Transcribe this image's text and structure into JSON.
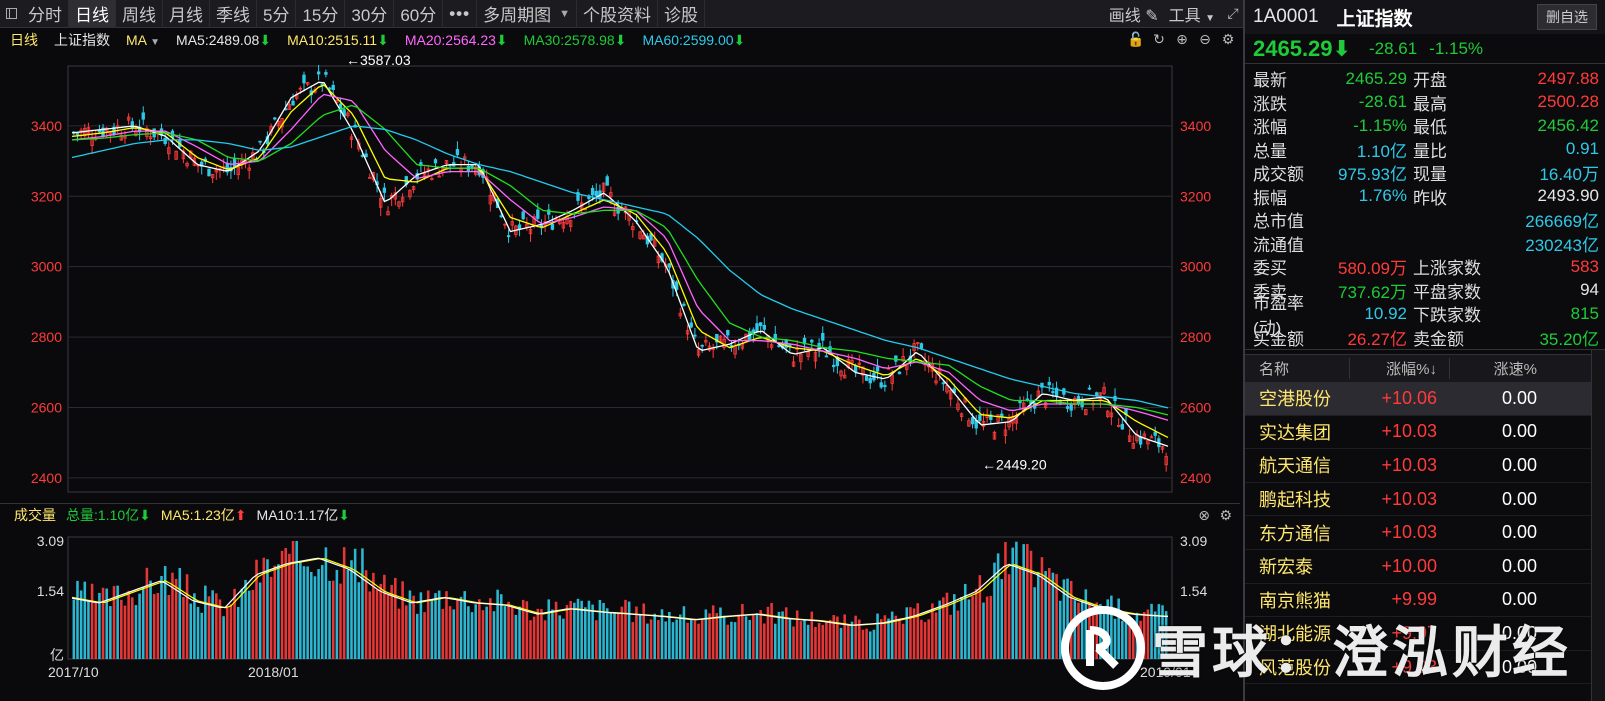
{
  "toolbar": {
    "tabs": [
      {
        "label": "分时"
      },
      {
        "label": "日线"
      },
      {
        "label": "周线"
      },
      {
        "label": "月线"
      },
      {
        "label": "季线"
      },
      {
        "label": "5分"
      },
      {
        "label": "15分"
      },
      {
        "label": "30分"
      },
      {
        "label": "60分"
      },
      {
        "label": "•••"
      },
      {
        "label": "多周期图"
      },
      {
        "label": "个股资料"
      },
      {
        "label": "诊股"
      }
    ],
    "active_tab": "日线",
    "draw_label": "画线",
    "tools_label": "工具"
  },
  "infobar": {
    "period": "日线",
    "name": "上证指数",
    "indicator": "MA",
    "ma5": "MA5:2489.08",
    "ma10": "MA10:2515.11",
    "ma20": "MA20:2564.23",
    "ma30": "MA30:2578.98",
    "ma60": "MA60:2599.00"
  },
  "chart_data": {
    "type": "line",
    "title": "上证指数",
    "y_ticks": [
      3400,
      3200,
      3000,
      2800,
      2600,
      2400
    ],
    "ylim": [
      2360,
      3570
    ],
    "x_ticks": [
      "2017/10",
      "2018/01",
      "2019/01"
    ],
    "annotations": [
      {
        "text": "←3587.03",
        "value": 3587.03
      },
      {
        "text": "←2449.20",
        "value": 2449.2
      }
    ],
    "series": [
      {
        "name": "MA5",
        "color": "#ffffff",
        "values": [
          3380,
          3390,
          3400,
          3370,
          3290,
          3270,
          3330,
          3480,
          3530,
          3380,
          3180,
          3260,
          3290,
          3290,
          3100,
          3120,
          3160,
          3210,
          3130,
          3000,
          2760,
          2780,
          2820,
          2750,
          2770,
          2700,
          2680,
          2760,
          2660,
          2550,
          2560,
          2640,
          2620,
          2630,
          2520,
          2490
        ]
      },
      {
        "name": "MA10",
        "color": "#ffff00",
        "values": [
          3370,
          3380,
          3395,
          3380,
          3310,
          3275,
          3310,
          3440,
          3520,
          3430,
          3250,
          3240,
          3280,
          3280,
          3140,
          3110,
          3150,
          3190,
          3150,
          3040,
          2820,
          2770,
          2800,
          2770,
          2760,
          2720,
          2690,
          2740,
          2680,
          2580,
          2570,
          2620,
          2620,
          2620,
          2560,
          2515
        ]
      },
      {
        "name": "MA20",
        "color": "#ff66ff",
        "values": [
          3360,
          3370,
          3385,
          3385,
          3340,
          3290,
          3300,
          3390,
          3490,
          3470,
          3330,
          3250,
          3270,
          3270,
          3190,
          3120,
          3140,
          3170,
          3160,
          3080,
          2880,
          2790,
          2790,
          2780,
          2760,
          2740,
          2710,
          2730,
          2700,
          2620,
          2590,
          2610,
          2610,
          2610,
          2590,
          2564
        ]
      },
      {
        "name": "MA30",
        "color": "#22dd22",
        "values": [
          3360,
          3365,
          3375,
          3380,
          3360,
          3310,
          3300,
          3350,
          3430,
          3460,
          3390,
          3290,
          3280,
          3280,
          3230,
          3160,
          3150,
          3160,
          3160,
          3110,
          2960,
          2840,
          2800,
          2790,
          2770,
          2760,
          2740,
          2730,
          2720,
          2660,
          2620,
          2620,
          2610,
          2610,
          2600,
          2579
        ]
      },
      {
        "name": "MA60",
        "color": "#22ccee",
        "values": [
          3310,
          3330,
          3350,
          3360,
          3360,
          3350,
          3330,
          3340,
          3370,
          3400,
          3390,
          3360,
          3320,
          3290,
          3270,
          3240,
          3210,
          3190,
          3170,
          3150,
          3080,
          2990,
          2920,
          2880,
          2850,
          2820,
          2790,
          2770,
          2740,
          2710,
          2680,
          2660,
          2640,
          2630,
          2620,
          2599
        ]
      }
    ]
  },
  "volume": {
    "label": "成交量",
    "total": "总量:1.10亿",
    "ma5": "MA5:1.23亿",
    "ma10": "MA10:1.17亿",
    "ticks": [
      "3.09",
      "1.54",
      "亿"
    ]
  },
  "right": {
    "code": "1A0001",
    "name": "上证指数",
    "del_btn": "删自选",
    "price": "2465.29",
    "change": "-28.61",
    "pct": "-1.15%",
    "quote_rows": [
      {
        "l1": "最新",
        "v1": "2465.29",
        "c1": "g",
        "l2": "开盘",
        "v2": "2497.88",
        "c2": "r"
      },
      {
        "l1": "涨跌",
        "v1": "-28.61",
        "c1": "g",
        "l2": "最高",
        "v2": "2500.28",
        "c2": "r"
      },
      {
        "l1": "涨幅",
        "v1": "-1.15%",
        "c1": "g",
        "l2": "最低",
        "v2": "2456.42",
        "c2": "g"
      },
      {
        "l1": "总量",
        "v1": "1.10亿",
        "c1": "c",
        "l2": "量比",
        "v2": "0.91",
        "c2": "c"
      },
      {
        "l1": "成交额",
        "v1": "975.93亿",
        "c1": "c",
        "l2": "现量",
        "v2": "16.40万",
        "c2": "c"
      },
      {
        "l1": "振幅",
        "v1": "1.76%",
        "c1": "c",
        "l2": "昨收",
        "v2": "2493.90",
        "c2": "w"
      },
      {
        "l1": "总市值",
        "v1": "",
        "c1": "c",
        "l2": "",
        "v2": "266669亿",
        "c2": "c"
      },
      {
        "l1": "流通值",
        "v1": "",
        "c1": "c",
        "l2": "",
        "v2": "230243亿",
        "c2": "c"
      },
      {
        "l1": "委买",
        "v1": "580.09万",
        "c1": "r",
        "l2": "上涨家数",
        "v2": "583",
        "c2": "r"
      },
      {
        "l1": "委卖",
        "v1": "737.62万",
        "c1": "g",
        "l2": "平盘家数",
        "v2": "94",
        "c2": "w"
      },
      {
        "l1": "市盈率(动)",
        "v1": "10.92",
        "c1": "c",
        "l2": "下跌家数",
        "v2": "815",
        "c2": "g"
      },
      {
        "l1": "买金额",
        "v1": "26.27亿",
        "c1": "r",
        "l2": "卖金额",
        "v2": "35.20亿",
        "c2": "g"
      }
    ],
    "list_header": {
      "name": "名称",
      "pct": "涨幅%↓",
      "speed": "涨速%"
    },
    "list": [
      {
        "name": "空港股份",
        "pct": "+10.06",
        "speed": "0.00"
      },
      {
        "name": "实达集团",
        "pct": "+10.03",
        "speed": "0.00"
      },
      {
        "name": "航天通信",
        "pct": "+10.03",
        "speed": "0.00"
      },
      {
        "name": "鹏起科技",
        "pct": "+10.03",
        "speed": "0.00"
      },
      {
        "name": "东方通信",
        "pct": "+10.03",
        "speed": "0.00"
      },
      {
        "name": "新宏泰",
        "pct": "+10.00",
        "speed": "0.00"
      },
      {
        "name": "南京熊猫",
        "pct": "+9.99",
        "speed": "0.00"
      },
      {
        "name": "湖北能源",
        "pct": "+9.97",
        "speed": "0.00"
      },
      {
        "name": "风范股份",
        "pct": "+9.93",
        "speed": "0.00"
      }
    ]
  },
  "watermark": "雪球：澄泓财经"
}
